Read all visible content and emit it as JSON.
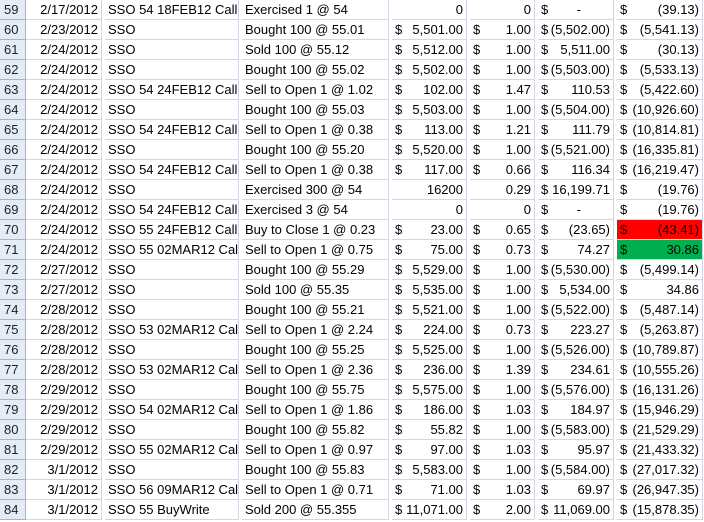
{
  "sheet": {
    "rows": [
      {
        "n": "59",
        "date": "2/17/2012",
        "sym": "SSO 54 18FEB12 Call",
        "act": "Exercised 1 @ 54",
        "e": {
          "t": "plain",
          "v": "0"
        },
        "f": {
          "t": "plain",
          "v": "0"
        },
        "g": {
          "t": "dash",
          "s": "$",
          "v": "-"
        },
        "h": {
          "t": "acc",
          "s": "$",
          "v": "(39.13)"
        }
      },
      {
        "n": "60",
        "date": "2/23/2012",
        "sym": "SSO",
        "act": "Bought 100 @ 55.01",
        "e": {
          "t": "acc",
          "s": "$",
          "v": "5,501.00"
        },
        "f": {
          "t": "acc",
          "s": "$",
          "v": "1.00"
        },
        "g": {
          "t": "acc",
          "s": "$",
          "v": "(5,502.00)"
        },
        "h": {
          "t": "acc",
          "s": "$",
          "v": "(5,541.13)"
        }
      },
      {
        "n": "61",
        "date": "2/24/2012",
        "sym": "SSO",
        "act": "Sold 100 @ 55.12",
        "e": {
          "t": "acc",
          "s": "$",
          "v": "5,512.00"
        },
        "f": {
          "t": "acc",
          "s": "$",
          "v": "1.00"
        },
        "g": {
          "t": "acc",
          "s": "$",
          "v": "5,511.00"
        },
        "h": {
          "t": "acc",
          "s": "$",
          "v": "(30.13)"
        }
      },
      {
        "n": "62",
        "date": "2/24/2012",
        "sym": "SSO",
        "act": "Bought 100 @ 55.02",
        "e": {
          "t": "acc",
          "s": "$",
          "v": "5,502.00"
        },
        "f": {
          "t": "acc",
          "s": "$",
          "v": "1.00"
        },
        "g": {
          "t": "acc",
          "s": "$",
          "v": "(5,503.00)"
        },
        "h": {
          "t": "acc",
          "s": "$",
          "v": "(5,533.13)"
        }
      },
      {
        "n": "63",
        "date": "2/24/2012",
        "sym": "SSO 54 24FEB12 Call",
        "act": "Sell to Open 1 @ 1.02",
        "e": {
          "t": "acc",
          "s": "$",
          "v": "102.00"
        },
        "f": {
          "t": "acc",
          "s": "$",
          "v": "1.47"
        },
        "g": {
          "t": "acc",
          "s": "$",
          "v": "110.53"
        },
        "h": {
          "t": "acc",
          "s": "$",
          "v": "(5,422.60)"
        }
      },
      {
        "n": "64",
        "date": "2/24/2012",
        "sym": "SSO",
        "act": "Bought 100 @ 55.03",
        "e": {
          "t": "acc",
          "s": "$",
          "v": "5,503.00"
        },
        "f": {
          "t": "acc",
          "s": "$",
          "v": "1.00"
        },
        "g": {
          "t": "acc",
          "s": "$",
          "v": "(5,504.00)"
        },
        "h": {
          "t": "acc",
          "s": "$",
          "v": "(10,926.60)"
        }
      },
      {
        "n": "65",
        "date": "2/24/2012",
        "sym": "SSO 54 24FEB12 Call",
        "act": "Sell to Open 1 @ 0.38",
        "e": {
          "t": "acc",
          "s": "$",
          "v": "113.00"
        },
        "f": {
          "t": "acc",
          "s": "$",
          "v": "1.21"
        },
        "g": {
          "t": "acc",
          "s": "$",
          "v": "111.79"
        },
        "h": {
          "t": "acc",
          "s": "$",
          "v": "(10,814.81)"
        }
      },
      {
        "n": "66",
        "date": "2/24/2012",
        "sym": "SSO",
        "act": "Bought 100 @ 55.20",
        "e": {
          "t": "acc",
          "s": "$",
          "v": "5,520.00"
        },
        "f": {
          "t": "acc",
          "s": "$",
          "v": "1.00"
        },
        "g": {
          "t": "acc",
          "s": "$",
          "v": "(5,521.00)"
        },
        "h": {
          "t": "acc",
          "s": "$",
          "v": "(16,335.81)"
        }
      },
      {
        "n": "67",
        "date": "2/24/2012",
        "sym": "SSO 54 24FEB12 Call",
        "act": "Sell to Open 1 @ 0.38",
        "e": {
          "t": "acc",
          "s": "$",
          "v": "117.00"
        },
        "f": {
          "t": "acc",
          "s": "$",
          "v": "0.66"
        },
        "g": {
          "t": "acc",
          "s": "$",
          "v": "116.34"
        },
        "h": {
          "t": "acc",
          "s": "$",
          "v": "(16,219.47)"
        }
      },
      {
        "n": "68",
        "date": "2/24/2012",
        "sym": "SSO",
        "act": "Exercised 300 @ 54",
        "e": {
          "t": "plain",
          "v": "16200"
        },
        "f": {
          "t": "plain",
          "v": "0.29"
        },
        "g": {
          "t": "acc",
          "s": "$",
          "v": "16,199.71"
        },
        "h": {
          "t": "acc",
          "s": "$",
          "v": "(19.76)"
        }
      },
      {
        "n": "69",
        "date": "2/24/2012",
        "sym": "SSO 54 24FEB12 Call",
        "act": "Exercised 3 @ 54",
        "e": {
          "t": "plain",
          "v": "0"
        },
        "f": {
          "t": "plain",
          "v": "0"
        },
        "g": {
          "t": "dash",
          "s": "$",
          "v": "-"
        },
        "h": {
          "t": "acc",
          "s": "$",
          "v": "(19.76)"
        }
      },
      {
        "n": "70",
        "date": "2/24/2012",
        "sym": "SSO 55 24FEB12 Call",
        "act": "Buy to Close 1 @ 0.23",
        "e": {
          "t": "acc",
          "s": "$",
          "v": "23.00"
        },
        "f": {
          "t": "acc",
          "s": "$",
          "v": "0.65"
        },
        "g": {
          "t": "acc",
          "s": "$",
          "v": "(23.65)"
        },
        "h": {
          "t": "acc",
          "s": "$",
          "v": "(43.41)",
          "hl": "red"
        }
      },
      {
        "n": "71",
        "date": "2/24/2012",
        "sym": "SSO 55 02MAR12 Call",
        "act": "Sell to Open 1 @ 0.75",
        "e": {
          "t": "acc",
          "s": "$",
          "v": "75.00"
        },
        "f": {
          "t": "acc",
          "s": "$",
          "v": "0.73"
        },
        "g": {
          "t": "acc",
          "s": "$",
          "v": "74.27"
        },
        "h": {
          "t": "acc",
          "s": "$",
          "v": "30.86",
          "hl": "green"
        }
      },
      {
        "n": "72",
        "date": "2/27/2012",
        "sym": "SSO",
        "act": "Bought 100 @ 55.29",
        "e": {
          "t": "acc",
          "s": "$",
          "v": "5,529.00"
        },
        "f": {
          "t": "acc",
          "s": "$",
          "v": "1.00"
        },
        "g": {
          "t": "acc",
          "s": "$",
          "v": "(5,530.00)"
        },
        "h": {
          "t": "acc",
          "s": "$",
          "v": "(5,499.14)"
        }
      },
      {
        "n": "73",
        "date": "2/27/2012",
        "sym": "SSO",
        "act": "Sold 100 @ 55.35",
        "e": {
          "t": "acc",
          "s": "$",
          "v": "5,535.00"
        },
        "f": {
          "t": "acc",
          "s": "$",
          "v": "1.00"
        },
        "g": {
          "t": "acc",
          "s": "$",
          "v": "5,534.00"
        },
        "h": {
          "t": "acc",
          "s": "$",
          "v": "34.86"
        }
      },
      {
        "n": "74",
        "date": "2/28/2012",
        "sym": "SSO",
        "act": "Bought 100 @ 55.21",
        "e": {
          "t": "acc",
          "s": "$",
          "v": "5,521.00"
        },
        "f": {
          "t": "acc",
          "s": "$",
          "v": "1.00"
        },
        "g": {
          "t": "acc",
          "s": "$",
          "v": "(5,522.00)"
        },
        "h": {
          "t": "acc",
          "s": "$",
          "v": "(5,487.14)"
        }
      },
      {
        "n": "75",
        "date": "2/28/2012",
        "sym": "SSO 53 02MAR12 Call",
        "act": "Sell to Open 1 @ 2.24",
        "e": {
          "t": "acc",
          "s": "$",
          "v": "224.00"
        },
        "f": {
          "t": "acc",
          "s": "$",
          "v": "0.73"
        },
        "g": {
          "t": "acc",
          "s": "$",
          "v": "223.27"
        },
        "h": {
          "t": "acc",
          "s": "$",
          "v": "(5,263.87)"
        }
      },
      {
        "n": "76",
        "date": "2/28/2012",
        "sym": "SSO",
        "act": "Bought 100 @ 55.25",
        "e": {
          "t": "acc",
          "s": "$",
          "v": "5,525.00"
        },
        "f": {
          "t": "acc",
          "s": "$",
          "v": "1.00"
        },
        "g": {
          "t": "acc",
          "s": "$",
          "v": "(5,526.00)"
        },
        "h": {
          "t": "acc",
          "s": "$",
          "v": "(10,789.87)"
        }
      },
      {
        "n": "77",
        "date": "2/28/2012",
        "sym": "SSO 53 02MAR12 Call",
        "act": "Sell to Open 1 @ 2.36",
        "e": {
          "t": "acc",
          "s": "$",
          "v": "236.00"
        },
        "f": {
          "t": "acc",
          "s": "$",
          "v": "1.39"
        },
        "g": {
          "t": "acc",
          "s": "$",
          "v": "234.61"
        },
        "h": {
          "t": "acc",
          "s": "$",
          "v": "(10,555.26)"
        }
      },
      {
        "n": "78",
        "date": "2/29/2012",
        "sym": "SSO",
        "act": "Bought 100 @ 55.75",
        "e": {
          "t": "acc",
          "s": "$",
          "v": "5,575.00"
        },
        "f": {
          "t": "acc",
          "s": "$",
          "v": "1.00"
        },
        "g": {
          "t": "acc",
          "s": "$",
          "v": "(5,576.00)"
        },
        "h": {
          "t": "acc",
          "s": "$",
          "v": "(16,131.26)"
        }
      },
      {
        "n": "79",
        "date": "2/29/2012",
        "sym": "SSO 54 02MAR12 Call",
        "act": "Sell to Open 1 @ 1.86",
        "e": {
          "t": "acc",
          "s": "$",
          "v": "186.00"
        },
        "f": {
          "t": "acc",
          "s": "$",
          "v": "1.03"
        },
        "g": {
          "t": "acc",
          "s": "$",
          "v": "184.97"
        },
        "h": {
          "t": "acc",
          "s": "$",
          "v": "(15,946.29)"
        }
      },
      {
        "n": "80",
        "date": "2/29/2012",
        "sym": "SSO",
        "act": "Bought 100 @ 55.82",
        "e": {
          "t": "acc",
          "s": "$",
          "v": "55.82"
        },
        "f": {
          "t": "acc",
          "s": "$",
          "v": "1.00"
        },
        "g": {
          "t": "acc",
          "s": "$",
          "v": "(5,583.00)"
        },
        "h": {
          "t": "acc",
          "s": "$",
          "v": "(21,529.29)"
        }
      },
      {
        "n": "81",
        "date": "2/29/2012",
        "sym": "SSO 55 02MAR12 Call",
        "act": "Sell to Open 1 @ 0.97",
        "e": {
          "t": "acc",
          "s": "$",
          "v": "97.00"
        },
        "f": {
          "t": "acc",
          "s": "$",
          "v": "1.03"
        },
        "g": {
          "t": "acc",
          "s": "$",
          "v": "95.97"
        },
        "h": {
          "t": "acc",
          "s": "$",
          "v": "(21,433.32)"
        }
      },
      {
        "n": "82",
        "date": "3/1/2012",
        "sym": "SSO",
        "act": "Bought 100 @ 55.83",
        "e": {
          "t": "acc",
          "s": "$",
          "v": "5,583.00"
        },
        "f": {
          "t": "acc",
          "s": "$",
          "v": "1.00"
        },
        "g": {
          "t": "acc",
          "s": "$",
          "v": "(5,584.00)"
        },
        "h": {
          "t": "acc",
          "s": "$",
          "v": "(27,017.32)"
        }
      },
      {
        "n": "83",
        "date": "3/1/2012",
        "sym": "SSO 56 09MAR12 Call",
        "act": "Sell to Open 1 @ 0.71",
        "e": {
          "t": "acc",
          "s": "$",
          "v": "71.00"
        },
        "f": {
          "t": "acc",
          "s": "$",
          "v": "1.03"
        },
        "g": {
          "t": "acc",
          "s": "$",
          "v": "69.97"
        },
        "h": {
          "t": "acc",
          "s": "$",
          "v": "(26,947.35)"
        }
      },
      {
        "n": "84",
        "date": "3/1/2012",
        "sym": "SSO 55 BuyWrite",
        "act": "Sold 200 @ 55.355",
        "e": {
          "t": "acc",
          "s": "$",
          "v": "11,071.00"
        },
        "f": {
          "t": "acc",
          "s": "$",
          "v": "2.00"
        },
        "g": {
          "t": "acc",
          "s": "$",
          "v": "11,069.00"
        },
        "h": {
          "t": "acc",
          "s": "$",
          "v": "(15,878.35)"
        }
      }
    ]
  },
  "colors": {
    "highlight_red": "#ff0000",
    "highlight_green": "#00b050",
    "gridline": "#d0d7e5",
    "row_header": "#e4ecf7"
  }
}
